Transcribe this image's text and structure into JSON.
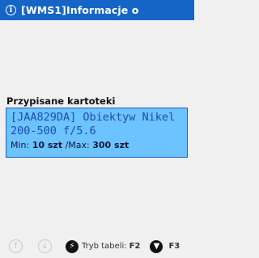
{
  "header": {
    "title": "[WMS1]Informacje  o",
    "icon": "info-icon",
    "background": "#1565c6"
  },
  "section": {
    "label": "Przypisane kartoteki"
  },
  "card": {
    "line1": "[JAA829DA] Obiektyw Nikel",
    "line2": "200-500 f/5.6",
    "min_label": "Min:",
    "min_value": "10 szt",
    "max_label": "/Max:",
    "max_value": "300 szt",
    "background": "#6cc3ff",
    "border": "#1a63c4"
  },
  "footer": {
    "up_icon": "arrow-up-icon",
    "down_icon": "arrow-down-icon",
    "table_mode_label": "Tryb tabeli:",
    "table_mode_key": "F2",
    "table_mode_icon": "lightning-icon",
    "filter_key": "F3",
    "filter_icon": "filter-icon"
  }
}
